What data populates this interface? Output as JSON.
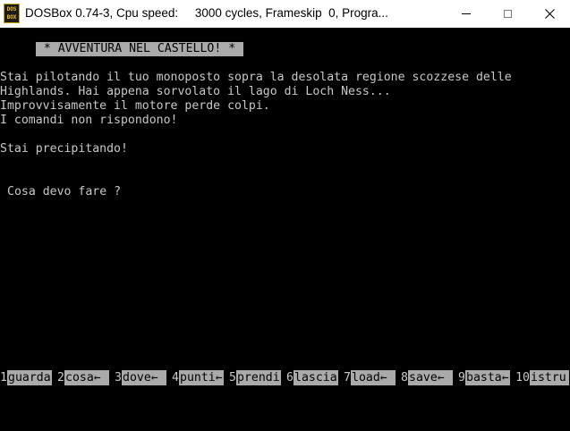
{
  "window": {
    "title": "DOSBox 0.74-3, Cpu speed:     3000 cycles, Frameskip  0, Progra...",
    "icon_top": "DOS",
    "icon_bottom": "BOX",
    "icons": {
      "minimize": "minimize-icon",
      "maximize": "maximize-icon",
      "close": "close-icon"
    }
  },
  "screen": {
    "banner": " * AVVENTURA NEL CASTELLO! * ",
    "story": [
      "Stai pilotando il tuo monoposto sopra la desolata regione scozzese delle",
      "Highlands. Hai appena sorvolato il lago di Loch Ness...",
      "Improvvisamente il motore perde colpi.",
      "I comandi non rispondono!",
      "Stai precipitando!"
    ],
    "prompt": "Cosa devo fare ?"
  },
  "fkeys": [
    {
      "num": "1",
      "label": "guarda"
    },
    {
      "num": "2",
      "label": "cosa←"
    },
    {
      "num": "3",
      "label": "dove←"
    },
    {
      "num": "4",
      "label": "punti←"
    },
    {
      "num": "5",
      "label": "prendi"
    },
    {
      "num": "6",
      "label": "lascia"
    },
    {
      "num": "7",
      "label": "load←"
    },
    {
      "num": "8",
      "label": "save←"
    },
    {
      "num": "9",
      "label": "basta←"
    },
    {
      "num": "10",
      "label": "istru"
    }
  ],
  "colors": {
    "screen_bg": "#000000",
    "text": "#c8c8c8",
    "highlight": "#aaaaaa"
  }
}
